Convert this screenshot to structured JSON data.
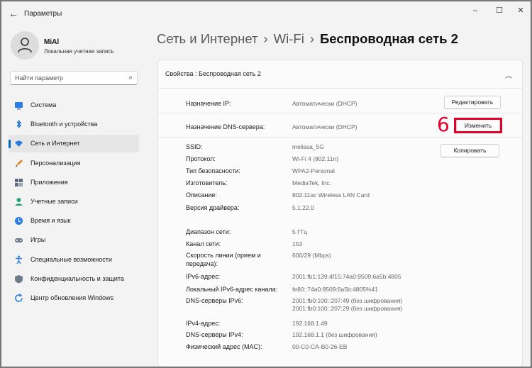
{
  "window": {
    "back_icon": "arrow-left-icon",
    "title": "Параметры",
    "controls": {
      "minimize": "–",
      "maximize": "☐",
      "close": "✕"
    }
  },
  "profile": {
    "name": "MiAl",
    "subtitle": "Локальная учетная запись"
  },
  "search": {
    "placeholder": "Найти параметр",
    "icon": "search-icon"
  },
  "sidebar": {
    "items": [
      {
        "label": "Система",
        "icon": "system-icon",
        "color": "#2b7de0"
      },
      {
        "label": "Bluetooth и устройства",
        "icon": "bluetooth-icon",
        "color": "#1a6fc9"
      },
      {
        "label": "Сеть и Интернет",
        "icon": "wifi-icon",
        "color": "#2b7de0",
        "active": true
      },
      {
        "label": "Персонализация",
        "icon": "brush-icon",
        "color": "#e2832e"
      },
      {
        "label": "Приложения",
        "icon": "apps-icon",
        "color": "#5b6a7a"
      },
      {
        "label": "Учетные записи",
        "icon": "accounts-icon",
        "color": "#28a27c"
      },
      {
        "label": "Время и язык",
        "icon": "time-language-icon",
        "color": "#2b7de0"
      },
      {
        "label": "Игры",
        "icon": "gaming-icon",
        "color": "#6d7b8a"
      },
      {
        "label": "Специальные возможности",
        "icon": "accessibility-icon",
        "color": "#2b7de0"
      },
      {
        "label": "Конфиденциальность и защита",
        "icon": "shield-icon",
        "color": "#6d7b8a"
      },
      {
        "label": "Центр обновления Windows",
        "icon": "update-icon",
        "color": "#2b7de0"
      }
    ]
  },
  "breadcrumb": {
    "part1": "Сеть и Интернет",
    "part2": "Wi-Fi",
    "current": "Беспроводная сеть 2",
    "separator": "›"
  },
  "panel": {
    "title": "Свойства : Беспроводная сеть 2",
    "collapse_icon": "chevron-up-icon",
    "ip": {
      "label": "Назначение IP:",
      "value": "Автоматически (DHCP)",
      "button": "Редактировать"
    },
    "dns": {
      "label": "Назначение DNS-сервера:",
      "value": "Автоматически (DHCP)",
      "button": "Изменить"
    },
    "copy_button": "Копировать",
    "annotation_number": "6",
    "properties": [
      {
        "label": "SSID:",
        "value": "melissa_5G"
      },
      {
        "label": "Протокол:",
        "value": "Wi-Fi 4 (802.11n)"
      },
      {
        "label": "Тип безопасности:",
        "value": "WPA2-Personal"
      },
      {
        "label": "Изготовитель:",
        "value": "MediaTek, Inc."
      },
      {
        "label": "Описание:",
        "value": "802.11ac Wireless LAN Card"
      },
      {
        "label": "Версия драйвера:",
        "value": "5.1.22.0"
      },
      {
        "label": "Диапазон сети:",
        "value": "5 ГГц"
      },
      {
        "label": "Канал сети:",
        "value": "153"
      },
      {
        "label": "Скорость линии (прием и",
        "label2": "передача):",
        "value": "600/29 (Mbps)"
      },
      {
        "label": "IPv6-адрес:",
        "value": "2001:fb1:139:4f15:74a0:9509:6a5b:4805"
      },
      {
        "label": "Локальный IPv6-адрес канала:",
        "value": "fe80::74a0:9509:6a5b:4805%41"
      },
      {
        "label": "DNS-серверы IPv6:",
        "value": "2001:fb0:100::207:49 (без шифрования)",
        "value2": "2001:fb0:100::207:29 (без шифрования)"
      },
      {
        "label": "IPv4-адрес:",
        "value": "192.168.1.49"
      },
      {
        "label": "DNS-серверы IPv4:",
        "value": "192.168.1.1 (без шифрования)"
      },
      {
        "label": "Физический адрес (MAC):",
        "value": "00-C0-CA-B0-26-EB"
      }
    ]
  },
  "colors": {
    "accent": "#0067c0",
    "annotation": "#e4002b"
  }
}
